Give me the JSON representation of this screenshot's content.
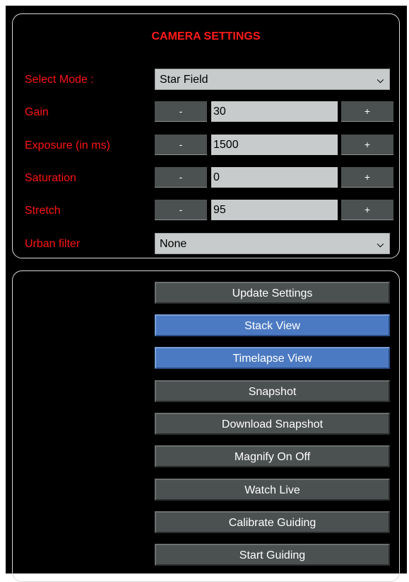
{
  "settings": {
    "title": "CAMERA SETTINGS",
    "select_mode": {
      "label": "Select Mode :",
      "value": "Star Field"
    },
    "gain": {
      "label": "Gain",
      "minus": "-",
      "value": "30",
      "plus": "+"
    },
    "exposure": {
      "label": "Exposure (in ms)",
      "minus": "-",
      "value": "1500",
      "plus": "+"
    },
    "saturation": {
      "label": "Saturation",
      "minus": "-",
      "value": "0",
      "plus": "+"
    },
    "stretch": {
      "label": "Stretch",
      "minus": "-",
      "value": "95",
      "plus": "+"
    },
    "urban_filter": {
      "label": "Urban filter",
      "value": "None"
    }
  },
  "actions": {
    "update_settings": "Update Settings",
    "stack_view": "Stack View",
    "timelapse_view": "Timelapse View",
    "snapshot": "Snapshot",
    "download_snapshot": "Download Snapshot",
    "magnify_on_off": "Magnify On Off",
    "watch_live": "Watch Live",
    "calibrate_guiding": "Calibrate Guiding",
    "start_guiding": "Start Guiding"
  },
  "colors": {
    "label_red": "#ff1414",
    "button_grey": "#4b5050",
    "button_blue": "#4c7ac2",
    "field_grey": "#c8cbcb"
  },
  "icons": {
    "dropdown": "chevron-down-icon"
  }
}
